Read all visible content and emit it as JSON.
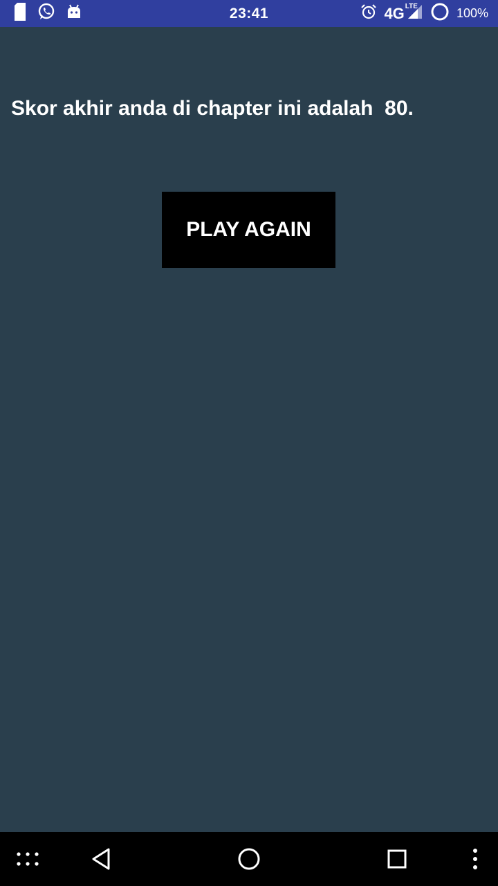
{
  "status_bar": {
    "time": "23:41",
    "network": "4G",
    "network_sub": "LTE",
    "battery": "100%",
    "left_icons": [
      "sim-card-icon",
      "whatsapp-icon",
      "android-icon"
    ],
    "right_icons": [
      "alarm-icon",
      "signal-icon",
      "circle-status-icon"
    ],
    "background": "#303f9f"
  },
  "content": {
    "score_message": "Skor akhir anda di chapter ini adalah  80.",
    "play_again_label": "PLAY AGAIN",
    "background": "#2a3f4d"
  },
  "nav_bar": {
    "buttons": [
      "apps-grid-icon",
      "back-icon",
      "home-icon",
      "recents-icon",
      "more-vert-icon"
    ]
  }
}
